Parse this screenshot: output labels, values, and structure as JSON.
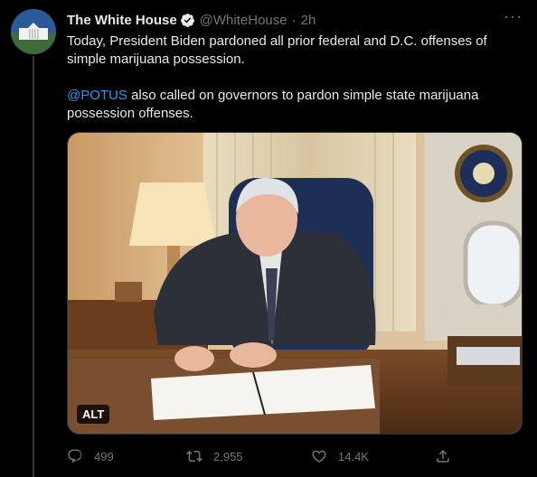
{
  "tweet": {
    "display_name": "The White House",
    "handle": "@WhiteHouse",
    "separator": "·",
    "time": "2h",
    "more_label": "···",
    "text_line1": "Today, President Biden pardoned all prior federal and D.C. offenses of simple marijuana possession.",
    "mention": "@POTUS",
    "text_line2": " also called on governors to pardon simple state marijuana possession offenses."
  },
  "media": {
    "alt_label": "ALT"
  },
  "actions": {
    "replies": "499",
    "retweets": "2,955",
    "likes": "14.4K"
  },
  "colors": {
    "background": "#000000",
    "text": "#e7e9ea",
    "secondary": "#71767b",
    "accent": "#1d9bf0"
  },
  "icons": [
    "verified-badge-icon",
    "more-icon",
    "reply-icon",
    "retweet-icon",
    "like-icon",
    "share-icon"
  ]
}
